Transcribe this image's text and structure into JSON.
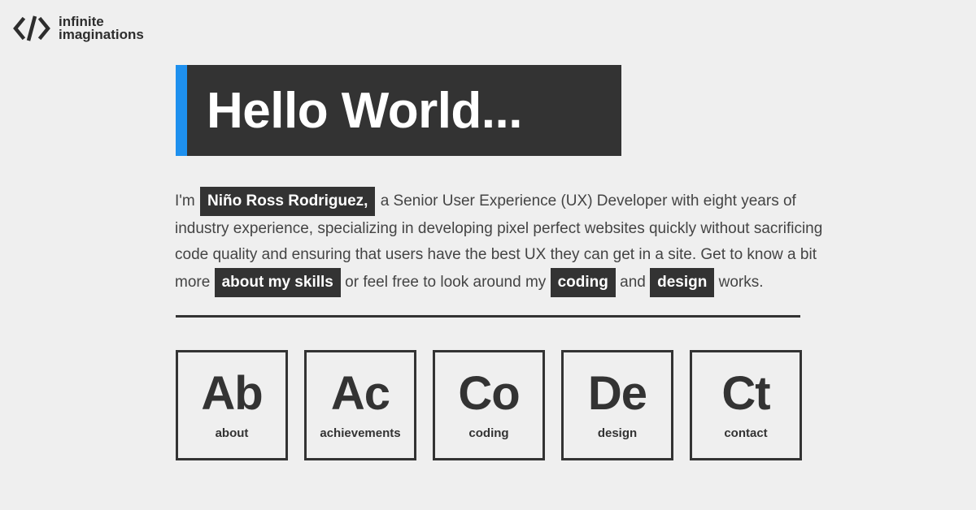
{
  "brand": {
    "icon": "code-brackets-icon",
    "line1": "infinite",
    "line2": "imaginations"
  },
  "hero": {
    "title": "Hello World...",
    "accent_color": "#1e90ee"
  },
  "intro": {
    "text_im": "I'm",
    "name": "Niño Ross Rodriguez,",
    "line1_rest": "a Senior User Experience (UX) Developer with eight years of",
    "line2": "industry experience, specializing in developing pixel perfect websites quickly without sacrificing",
    "line3": "code quality and ensuring that users have the best UX they can get in a site. Get to know a bit",
    "text_more": "more",
    "link_skills": "about my skills",
    "text_or": "or feel free to look around my",
    "link_coding": "coding",
    "text_and": "and",
    "link_design": "design",
    "text_works": "works."
  },
  "tiles": [
    {
      "symbol": "Ab",
      "label": "about"
    },
    {
      "symbol": "Ac",
      "label": "achievements"
    },
    {
      "symbol": "Co",
      "label": "coding"
    },
    {
      "symbol": "De",
      "label": "design"
    },
    {
      "symbol": "Ct",
      "label": "contact"
    }
  ]
}
